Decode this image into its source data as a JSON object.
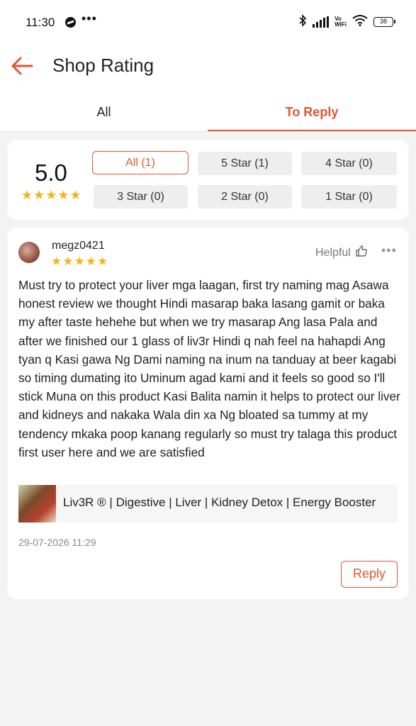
{
  "status_bar": {
    "time": "11:30",
    "messenger_icon": "messenger-icon",
    "more_dots": "•••",
    "bluetooth_icon": "bluetooth-icon",
    "vowifi": "Vo\nWiFi",
    "battery": "38"
  },
  "header": {
    "back_icon": "arrow-left-icon",
    "title": "Shop Rating"
  },
  "tabs": [
    {
      "label": "All",
      "active": false
    },
    {
      "label": "To Reply",
      "active": true
    }
  ],
  "rating": {
    "score": "5.0",
    "stars": "★★★★★",
    "filters": [
      {
        "label": "All (1)",
        "active": true
      },
      {
        "label": "5 Star (1)",
        "active": false
      },
      {
        "label": "4 Star (0)",
        "active": false
      },
      {
        "label": "3 Star (0)",
        "active": false
      },
      {
        "label": "2 Star (0)",
        "active": false
      },
      {
        "label": "1 Star (0)",
        "active": false
      }
    ]
  },
  "review": {
    "username": "megz0421",
    "stars": "★★★★★",
    "helpful_label": "Helpful",
    "more": "•••",
    "text": "Must try to protect your liver mga laagan, first try naming mag Asawa honest review we thought Hindi masarap baka lasang gamit or baka my after taste hehehe but when we try masarap Ang lasa Pala and after we finished our 1 glass of liv3r Hindi q nah feel na hahapdi Ang tyan q Kasi gawa Ng Dami naming na inum na tanduay at beer kagabi so timing dumating ito Uminum agad kami and it feels so good so I'll stick Muna on this product Kasi Balita namin it helps to protect our liver and kidneys and nakaka Wala din xa Ng bloated sa tummy at my tendency mkaka poop kanang regularly so must try talaga this product first user here and we are satisfied",
    "product_name": "Liv3R ® | Digestive | Liver | Kidney Detox |  Energy Booster",
    "date": "29-07-2026 11:29",
    "reply_label": "Reply"
  },
  "colors": {
    "accent": "#e8542f",
    "star": "#f6b316",
    "background": "#f3f3f3"
  }
}
